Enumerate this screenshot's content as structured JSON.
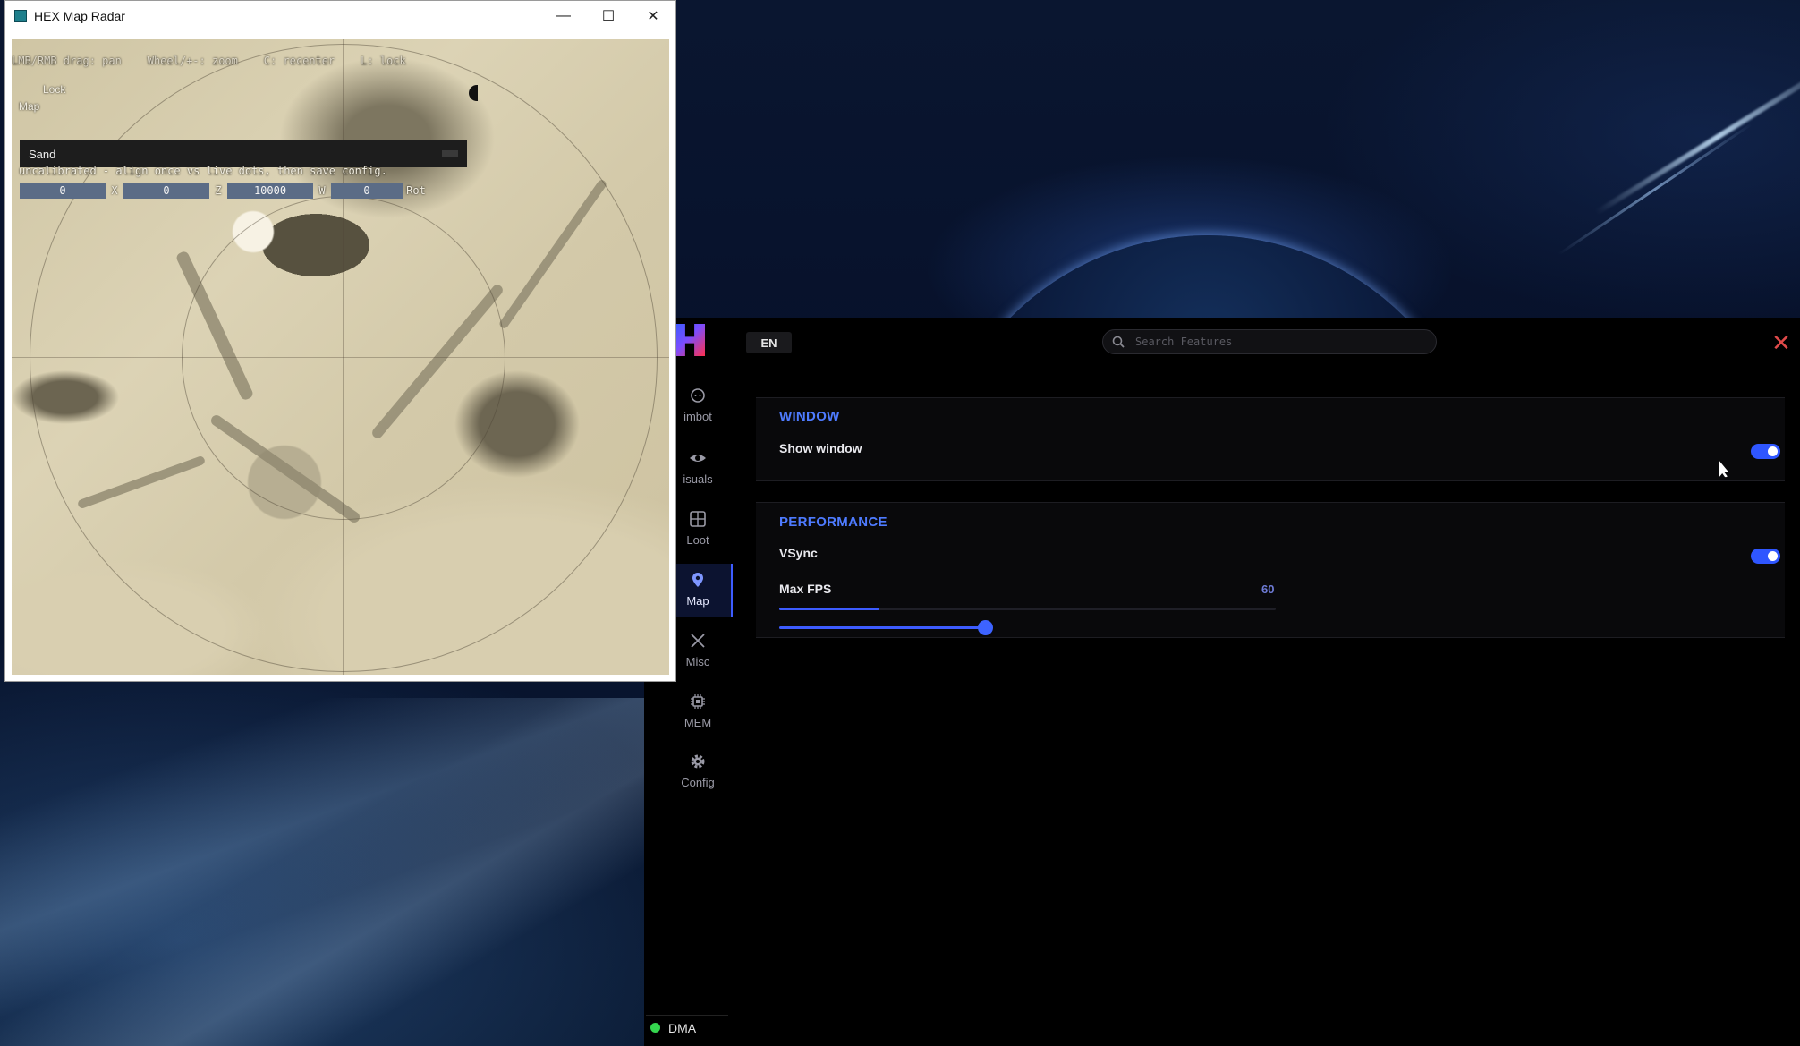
{
  "radar_window": {
    "title": "HEX Map Radar",
    "controls": {
      "minimize": "—",
      "maximize": "☐",
      "close": "✕"
    },
    "hint_bar": "LMB/RMB drag: pan    Wheel/+-: zoom    C: recenter    L: lock",
    "lock_label": "Lock",
    "map_label": "Map",
    "map_select_value": "Sand",
    "calibration_text": "uncalibrated - align once vs live dots, then save config.",
    "coords": [
      {
        "value": "0",
        "label": "X"
      },
      {
        "value": "0",
        "label": "Z"
      },
      {
        "value": "10000",
        "label": "W"
      },
      {
        "value": "0",
        "label": "Rot"
      }
    ]
  },
  "panel": {
    "language": "EN",
    "search": {
      "placeholder": "Search Features",
      "icon": "search-icon"
    },
    "close_icon": "close-icon",
    "accent_color": "#3d5cff",
    "nav": [
      {
        "label": "imbot",
        "icon": "aimbot-icon",
        "active": false
      },
      {
        "label": "isuals",
        "icon": "eye-icon",
        "active": false
      },
      {
        "label": "Loot",
        "icon": "loot-grid-icon",
        "active": false
      },
      {
        "label": "Map",
        "icon": "map-pin-icon",
        "active": true
      },
      {
        "label": "Misc",
        "icon": "tools-icon",
        "active": false
      },
      {
        "label": "MEM",
        "icon": "chip-icon",
        "active": false
      },
      {
        "label": "Config",
        "icon": "gear-icon",
        "active": false
      }
    ],
    "status": {
      "label": "DMA",
      "color": "#35d64f"
    },
    "sections": {
      "window": {
        "title": "WINDOW",
        "show_window_label": "Show window",
        "show_window_on": true
      },
      "performance": {
        "title": "PERFORMANCE",
        "vsync_label": "VSync",
        "vsync_on": true,
        "max_fps_label": "Max FPS",
        "max_fps_value": "60"
      }
    }
  }
}
